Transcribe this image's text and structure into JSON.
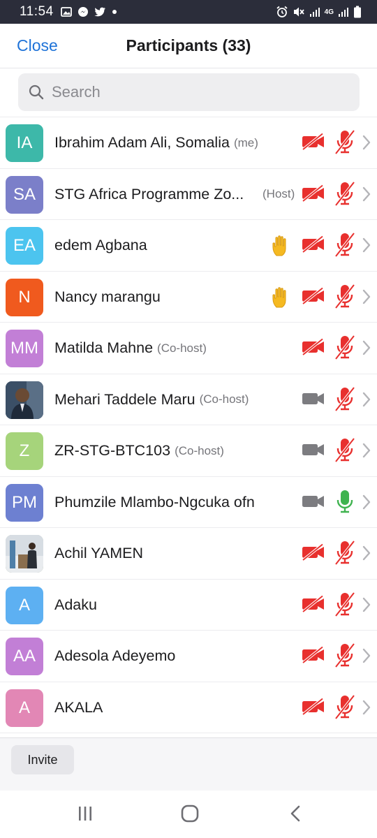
{
  "status_bar": {
    "time": "11:54",
    "network_label": "4G"
  },
  "header": {
    "close_label": "Close",
    "title": "Participants (33)"
  },
  "search": {
    "placeholder": "Search"
  },
  "participants": [
    {
      "initials": "IA",
      "name": "Ibrahim Adam Ali, Somalia",
      "tag": "(me)",
      "color": "#3db8a9",
      "video": "off",
      "mic": "muted",
      "hand": false,
      "photo": false
    },
    {
      "initials": "SA",
      "name": "STG Africa Programme Zo...",
      "tag": "(Host)",
      "color": "#7b7fc9",
      "video": "off",
      "mic": "muted",
      "hand": false,
      "photo": false
    },
    {
      "initials": "EA",
      "name": "edem Agbana",
      "tag": "",
      "color": "#4cc4ef",
      "video": "off",
      "mic": "muted",
      "hand": true,
      "photo": false
    },
    {
      "initials": "N",
      "name": "Nancy marangu",
      "tag": "",
      "color": "#f05a1e",
      "video": "off",
      "mic": "muted",
      "hand": true,
      "photo": false
    },
    {
      "initials": "MM",
      "name": "Matilda Mahne",
      "tag": "(Co-host)",
      "color": "#c27fd6",
      "video": "off",
      "mic": "muted",
      "hand": false,
      "photo": false
    },
    {
      "initials": "",
      "name": "Mehari Taddele Maru",
      "tag": "(Co-host)",
      "color": "#2b3e55",
      "video": "on",
      "mic": "muted",
      "hand": false,
      "photo": true
    },
    {
      "initials": "Z",
      "name": "ZR-STG-BTC103",
      "tag": "(Co-host)",
      "color": "#a6d47b",
      "video": "on",
      "mic": "muted",
      "hand": false,
      "photo": false
    },
    {
      "initials": "PM",
      "name": "Phumzile Mlambo-Ngcuka ofn",
      "tag": "",
      "color": "#6d80d1",
      "video": "on",
      "mic": "active",
      "hand": false,
      "photo": false
    },
    {
      "initials": "",
      "name": "Achil YAMEN",
      "tag": "",
      "color": "#6b7a5e",
      "video": "off",
      "mic": "muted",
      "hand": false,
      "photo": true
    },
    {
      "initials": "A",
      "name": "Adaku",
      "tag": "",
      "color": "#5db0f2",
      "video": "off",
      "mic": "muted",
      "hand": false,
      "photo": false
    },
    {
      "initials": "AA",
      "name": "Adesola Adeyemo",
      "tag": "",
      "color": "#c27fd6",
      "video": "off",
      "mic": "muted",
      "hand": false,
      "photo": false
    },
    {
      "initials": "A",
      "name": "AKALA",
      "tag": "",
      "color": "#e287b5",
      "video": "off",
      "mic": "muted",
      "hand": false,
      "photo": false
    }
  ],
  "footer": {
    "invite_label": "Invite"
  },
  "colors": {
    "accent": "#1f73d8",
    "muted_red": "#e8302e",
    "active_green": "#3fb34f",
    "icon_gray": "#7c7c80",
    "raised_hand": "#f5b921"
  }
}
